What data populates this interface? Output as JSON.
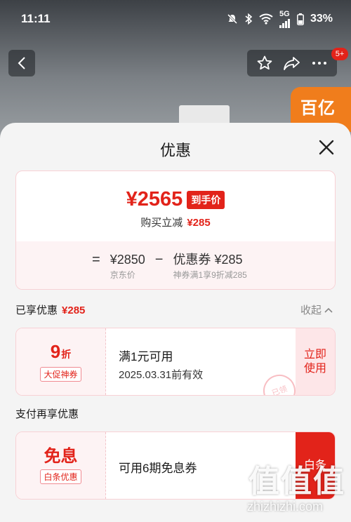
{
  "status_bar": {
    "time": "11:11",
    "network": "5G",
    "battery": "33%"
  },
  "background": {
    "cart_badge": "5+",
    "promo_text": "百亿"
  },
  "sheet": {
    "title": "优惠",
    "price_card": {
      "final_price": "¥2565",
      "final_price_tag": "到手价",
      "buy_discount_label": "购买立减",
      "buy_discount_amount": "¥285",
      "equals": "=",
      "jd_price": "¥2850",
      "jd_price_label": "京东价",
      "minus": "−",
      "coupon_value": "优惠券 ¥285",
      "coupon_desc": "神券满1享9折减285"
    },
    "enjoyed": {
      "label": "已享优惠",
      "amount": "¥285",
      "collapse_label": "收起"
    },
    "coupon1": {
      "discount_value": "9",
      "discount_unit": "折",
      "tag": "大促神券",
      "condition": "满1元可用",
      "expiry": "2025.03.31前有效",
      "action": "立即使用",
      "stamp": "已领"
    },
    "pay_section": {
      "label": "支付再享优惠"
    },
    "coupon2": {
      "title": "免息",
      "tag": "白条优惠",
      "desc": "可用6期免息券",
      "action": "白条"
    }
  },
  "watermark": {
    "logo": "值值值",
    "url": "zhizhizhi.com"
  },
  "colors": {
    "accent": "#e2231a",
    "card_border": "#f8d1d5",
    "card_tint": "#fdf3f4"
  }
}
